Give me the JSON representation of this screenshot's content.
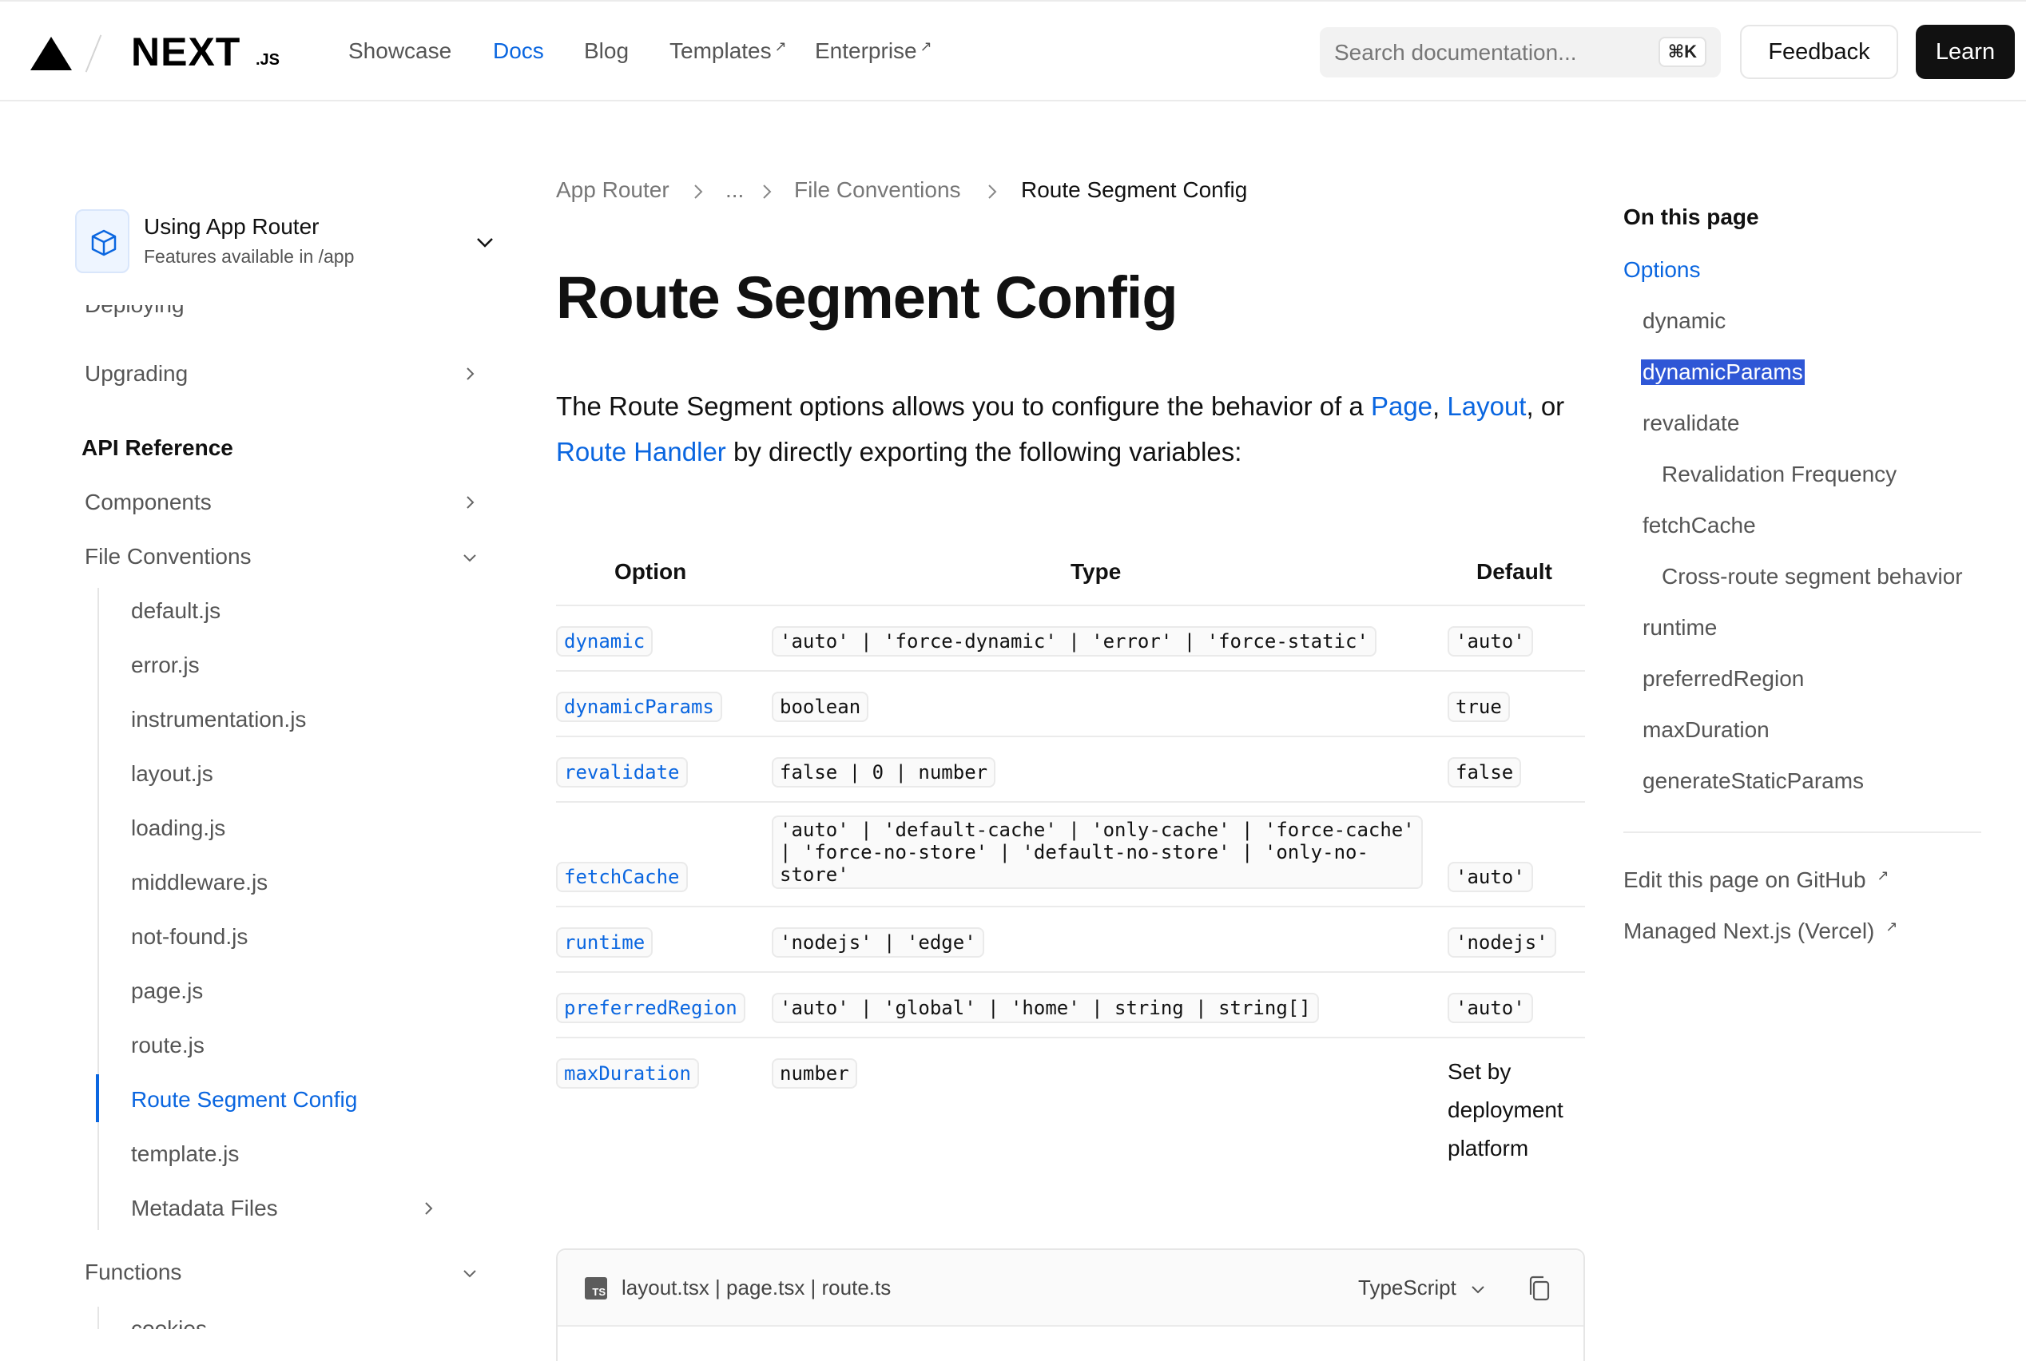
{
  "header": {
    "logo_text": "NEXT",
    "logo_suffix": ".JS",
    "nav": [
      {
        "label": "Showcase",
        "active": false,
        "external": false
      },
      {
        "label": "Docs",
        "active": true,
        "external": false
      },
      {
        "label": "Blog",
        "active": false,
        "external": false
      },
      {
        "label": "Templates",
        "active": false,
        "external": true
      },
      {
        "label": "Enterprise",
        "active": false,
        "external": true
      }
    ],
    "search_placeholder": "Search documentation...",
    "search_shortcut": "⌘K",
    "feedback_label": "Feedback",
    "learn_label": "Learn"
  },
  "sidebar": {
    "router_title": "Using App Router",
    "router_subtitle": "Features available in /app",
    "partial_item": "Deploying",
    "upgrading": "Upgrading",
    "api_heading": "API Reference",
    "components": "Components",
    "file_conventions": "File Conventions",
    "file_items": [
      "default.js",
      "error.js",
      "instrumentation.js",
      "layout.js",
      "loading.js",
      "middleware.js",
      "not-found.js",
      "page.js",
      "route.js",
      "Route Segment Config",
      "template.js",
      "Metadata Files"
    ],
    "active_item": "Route Segment Config",
    "functions": "Functions",
    "functions_partial": "cookies"
  },
  "breadcrumb": [
    "App Router",
    "...",
    "File Conventions",
    "Route Segment Config"
  ],
  "page": {
    "title": "Route Segment Config",
    "intro_1": "The Route Segment options allows you to configure the behavior of a ",
    "link_page": "Page",
    "intro_sep": ", ",
    "link_layout": "Layout",
    "intro_or": ", or",
    "link_route_handler": "Route Handler",
    "intro_2": " by directly exporting the following variables:"
  },
  "table": {
    "headers": [
      "Option",
      "Type",
      "Default"
    ],
    "rows": [
      {
        "option": "dynamic",
        "type": "'auto' | 'force-dynamic' | 'error' | 'force-static'",
        "default": "'auto'"
      },
      {
        "option": "dynamicParams",
        "type": "boolean",
        "default": "true"
      },
      {
        "option": "revalidate",
        "type": "false | 0 | number",
        "default": "false"
      },
      {
        "option": "fetchCache",
        "type": "'auto' | 'default-cache' | 'only-cache' | 'force-cache' | 'force-no-store' | 'default-no-store' | 'only-no-store'",
        "default": "'auto'"
      },
      {
        "option": "runtime",
        "type": "'nodejs' | 'edge'",
        "default": "'nodejs'"
      },
      {
        "option": "preferredRegion",
        "type": "'auto' | 'global' | 'home' | string | string[]",
        "default": "'auto'"
      },
      {
        "option": "maxDuration",
        "type": "number",
        "default": "Set by deployment platform"
      }
    ]
  },
  "code_block": {
    "files": "layout.tsx | page.tsx | route.ts",
    "language": "TypeScript",
    "ts_badge": "TS"
  },
  "toc": {
    "title": "On this page",
    "items": [
      "Options",
      "dynamic",
      "dynamicParams",
      "revalidate",
      "Revalidation Frequency",
      "fetchCache",
      "Cross-route segment behavior",
      "runtime",
      "preferredRegion",
      "maxDuration",
      "generateStaticParams"
    ],
    "selected": "dynamicParams",
    "edit_link": "Edit this page on GitHub",
    "managed_link": "Managed Next.js (Vercel)"
  },
  "colors": {
    "accent": "#0a66e0",
    "text": "#171717",
    "muted": "#555555",
    "selection": "#2f57d6"
  }
}
